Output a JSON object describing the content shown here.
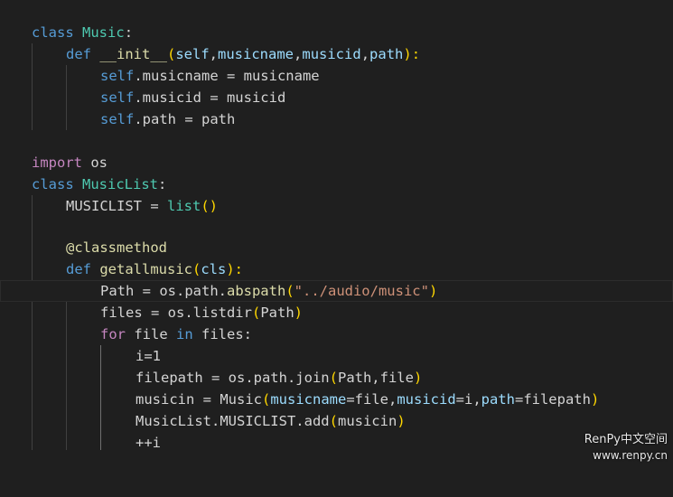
{
  "code": {
    "line1": [
      "class",
      " ",
      "Music",
      ":"
    ],
    "line2": [
      "def",
      " ",
      "__init__",
      "(",
      "self",
      ",",
      "musicname",
      ",",
      "musicid",
      ",",
      "path",
      "):"
    ],
    "line3": [
      "self",
      ".musicname = musicname"
    ],
    "line4": [
      "self",
      ".musicid = musicid"
    ],
    "line5": [
      "self",
      ".path = path"
    ],
    "line7": [
      "import",
      " os"
    ],
    "line8": [
      "class",
      " ",
      "MusicList",
      ":"
    ],
    "line9": [
      "MUSICLIST = ",
      "list",
      "()"
    ],
    "line11": [
      "@classmethod"
    ],
    "line12": [
      "def",
      " ",
      "getallmusic",
      "(",
      "cls",
      "):"
    ],
    "line13": [
      "Path = os.path.",
      "abspath",
      "(",
      "\"../audio/music\"",
      ")"
    ],
    "line14": [
      "files = os.listdir",
      "(",
      "Path",
      ")"
    ],
    "line15": [
      "for",
      " file ",
      "in",
      " files:"
    ],
    "line16": [
      "i=1"
    ],
    "line17": [
      "filepath = os.path.join",
      "(",
      "Path,file",
      ")"
    ],
    "line18": [
      "musicin = Music",
      "(",
      "musicname",
      "=file,",
      "musicid",
      "=i,",
      "path",
      "=filepath",
      ")"
    ],
    "line19": [
      "MusicList.MUSICLIST.add",
      "(",
      "musicin",
      ")"
    ],
    "line20": [
      "++i"
    ]
  },
  "watermark": {
    "line1": "RenPy中文空间",
    "line2": "www.renpy.cn"
  },
  "colors": {
    "background": "#1f1f1f",
    "keyword": "#569cd6",
    "control_keyword": "#c586c0",
    "class_name": "#4ec9b0",
    "function": "#dcdcaa",
    "variable": "#9cdcfe",
    "string": "#ce9178",
    "bracket": "#ffd700"
  }
}
